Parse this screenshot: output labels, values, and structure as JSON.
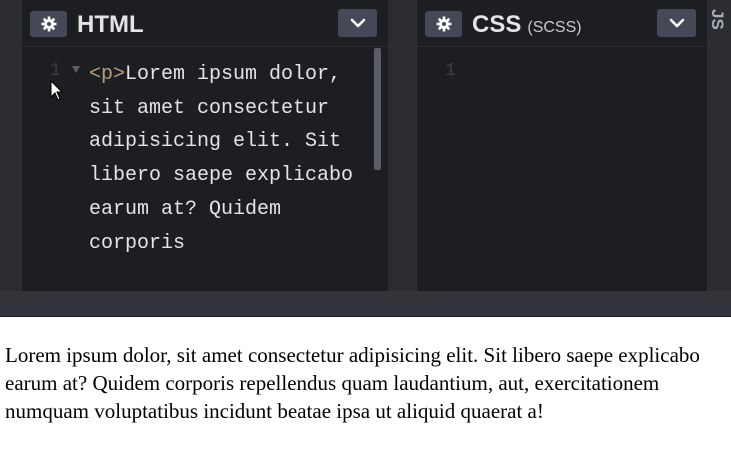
{
  "panels": {
    "html": {
      "title": "HTML",
      "line_number": "1",
      "code_tag": "<p>",
      "code_text": "Lorem ipsum dolor, sit amet consectetur adipisicing elit. Sit libero saepe explicabo earum at? Quidem corporis"
    },
    "css": {
      "title": "CSS",
      "subtitle": "(SCSS)",
      "line_number": "1"
    },
    "js": {
      "title": "JS"
    }
  },
  "preview": {
    "text": "Lorem ipsum dolor, sit amet consectetur adipisicing elit. Sit libero saepe explicabo earum at? Quidem corporis repellendus quam laudantium, aut, exercitationem numquam voluptatibus incidunt beatae ipsa ut aliquid quaerat a!"
  },
  "colors": {
    "editor_bg": "#1d1e22",
    "chrome_bg": "#2c2d33",
    "button_bg": "#444857",
    "tag_color": "#b4a07a",
    "text_color": "#e3e4e8"
  }
}
